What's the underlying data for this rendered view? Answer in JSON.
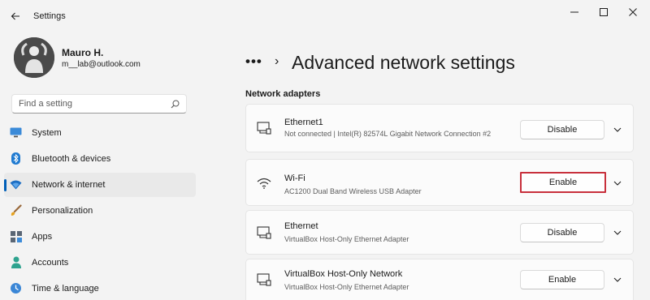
{
  "app": {
    "title": "Settings"
  },
  "user": {
    "name": "Mauro H.",
    "email": "m__lab@outlook.com"
  },
  "search": {
    "placeholder": "Find a setting"
  },
  "nav": [
    {
      "label": "System",
      "icon": "monitor-icon"
    },
    {
      "label": "Bluetooth & devices",
      "icon": "bluetooth-icon"
    },
    {
      "label": "Network & internet",
      "icon": "wifi-icon",
      "active": true
    },
    {
      "label": "Personalization",
      "icon": "brush-icon"
    },
    {
      "label": "Apps",
      "icon": "apps-icon"
    },
    {
      "label": "Accounts",
      "icon": "person-icon"
    },
    {
      "label": "Time & language",
      "icon": "clock-icon"
    }
  ],
  "breadcrumb": {
    "overflow": "•••",
    "separator": "›"
  },
  "page": {
    "title": "Advanced network settings",
    "section": "Network adapters"
  },
  "adapters": [
    {
      "name": "Ethernet1",
      "description": "Not connected | Intel(R) 82574L Gigabit Network Connection #2",
      "action": "Disable",
      "icon": "ethernet-icon"
    },
    {
      "name": "Wi-Fi",
      "description": "AC1200  Dual Band Wireless USB Adapter",
      "action": "Enable",
      "icon": "wifi-icon",
      "highlighted": true
    },
    {
      "name": "Ethernet",
      "description": "VirtualBox Host-Only Ethernet Adapter",
      "action": "Disable",
      "icon": "ethernet-icon"
    },
    {
      "name": "VirtualBox Host-Only Network",
      "description": "VirtualBox Host-Only Ethernet Adapter",
      "action": "Enable",
      "icon": "ethernet-icon"
    }
  ],
  "colors": {
    "accent": "#005fb8",
    "highlight": "#c8303c",
    "background": "#f3f3f3",
    "card": "#fbfbfb"
  }
}
